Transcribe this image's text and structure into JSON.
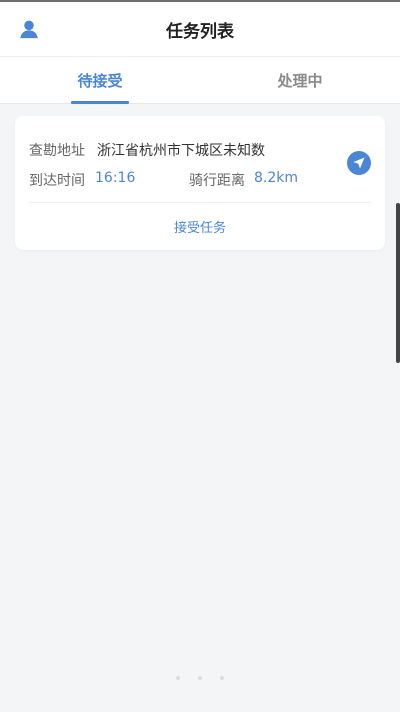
{
  "header": {
    "title": "任务列表"
  },
  "tabs": [
    {
      "label": "待接受",
      "active": true
    },
    {
      "label": "处理中",
      "active": false
    }
  ],
  "task": {
    "address_label": "查勘地址",
    "address_value": "浙江省杭州市下城区未知数",
    "arrival_label": "到达时间",
    "arrival_value": "16:16",
    "distance_label": "骑行距离",
    "distance_value": "8.2km",
    "accept_label": "接受任务"
  },
  "icons": {
    "avatar": "user-icon",
    "navigate": "navigation-arrow-icon"
  },
  "colors": {
    "accent": "#4a86d8",
    "background": "#f4f5f7",
    "card": "#ffffff"
  }
}
